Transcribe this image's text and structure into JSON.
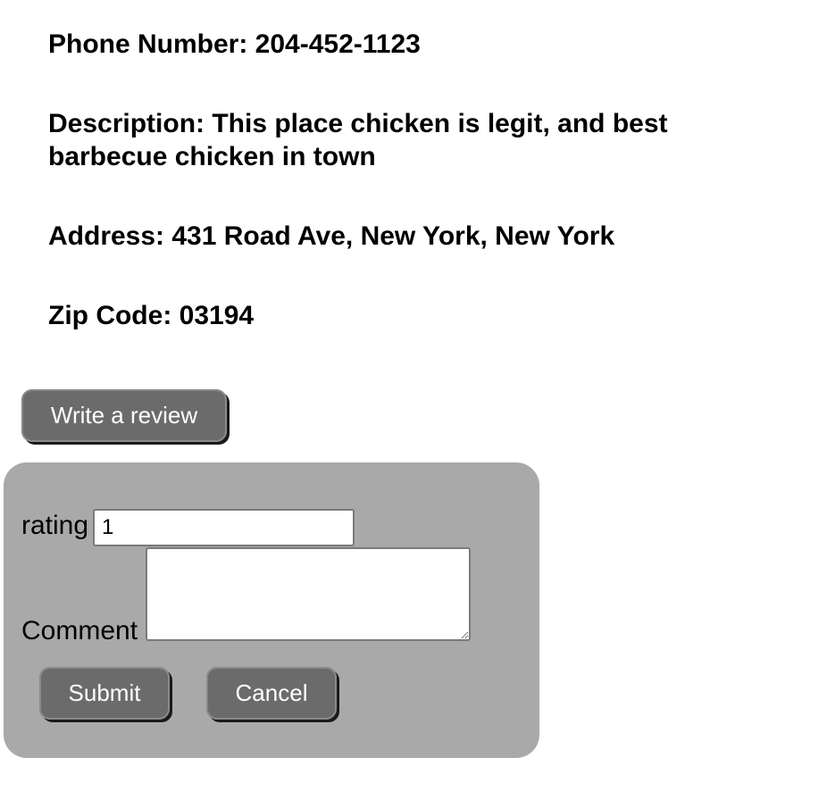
{
  "details": {
    "phone": "Phone Number: 204-452-1123",
    "description": "Description: This place chicken is legit, and best barbecue chicken in town",
    "address": "Address: 431 Road Ave, New York, New York",
    "zip": "Zip Code: 03194"
  },
  "write_review_label": "Write a review",
  "review_form": {
    "rating_label": "rating",
    "rating_value": "1",
    "comment_label": "Comment",
    "comment_value": "",
    "submit_label": "Submit",
    "cancel_label": "Cancel"
  }
}
